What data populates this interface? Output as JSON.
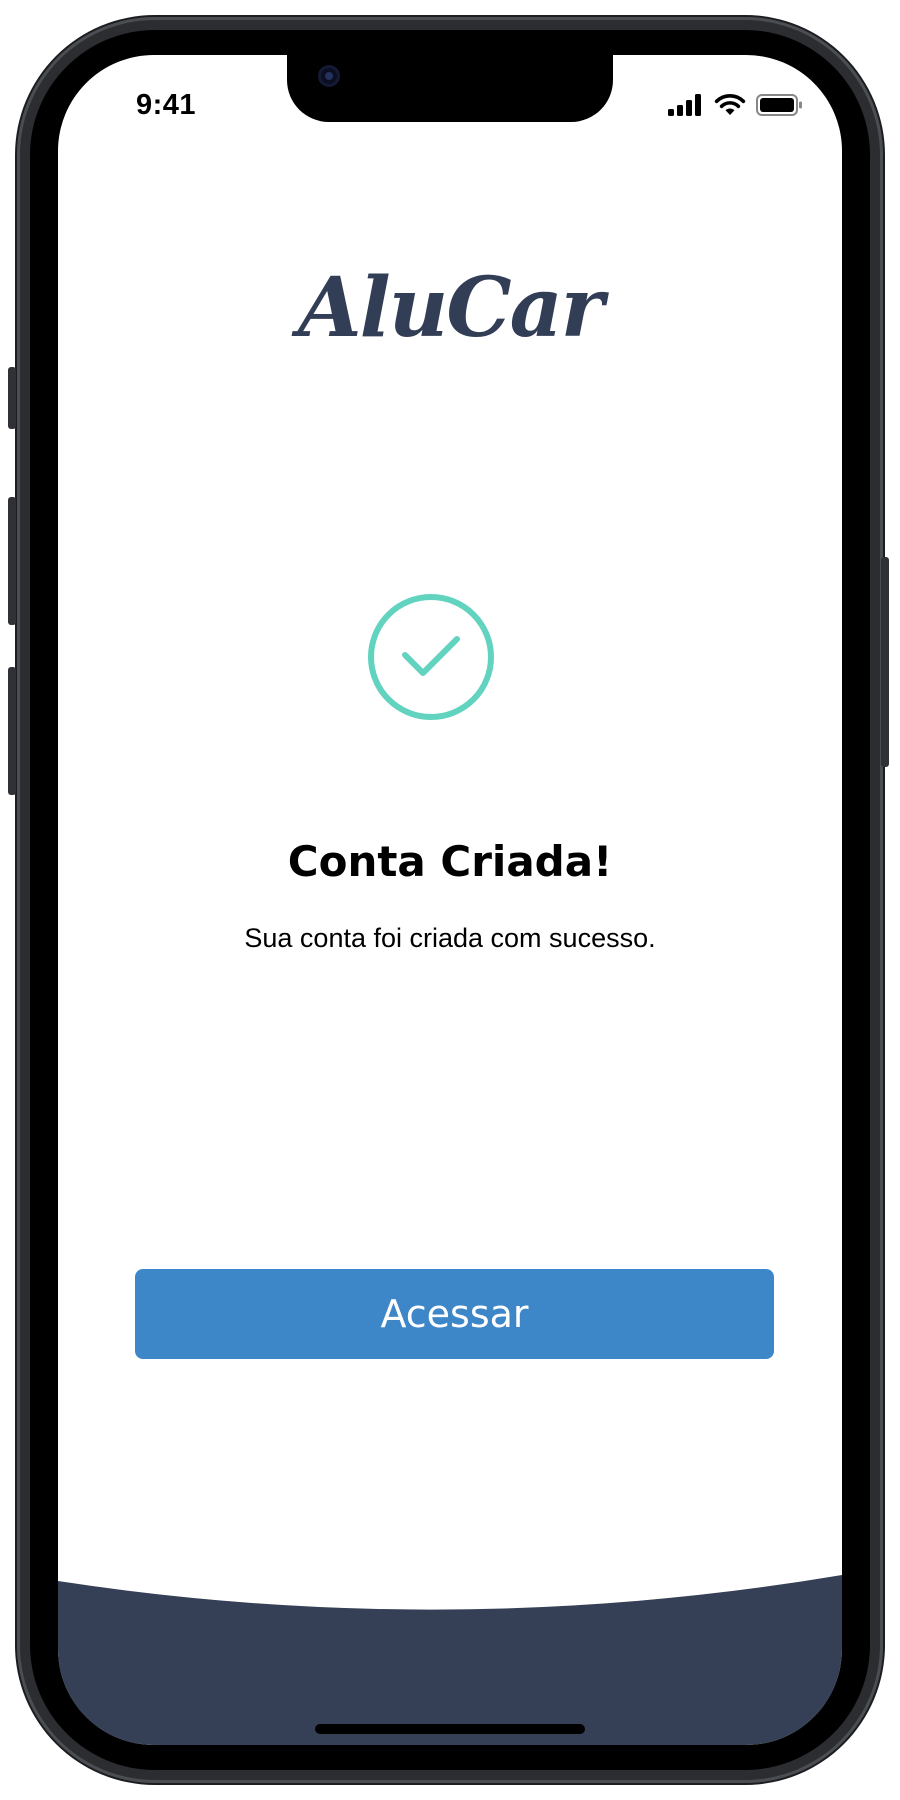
{
  "status_bar": {
    "time": "9:41",
    "icons": [
      "cellular-signal-icon",
      "wifi-icon",
      "battery-icon"
    ]
  },
  "logo": {
    "text": "AluCar",
    "color": "#323d56"
  },
  "success": {
    "icon": "check-circle-icon",
    "icon_color": "#62d3bf",
    "title": "Conta Criada!",
    "message": "Sua conta foi criada com sucesso."
  },
  "actions": {
    "access_label": "Acessar",
    "button_color": "#3d86c8"
  },
  "theme": {
    "footer_color": "#353f55"
  }
}
